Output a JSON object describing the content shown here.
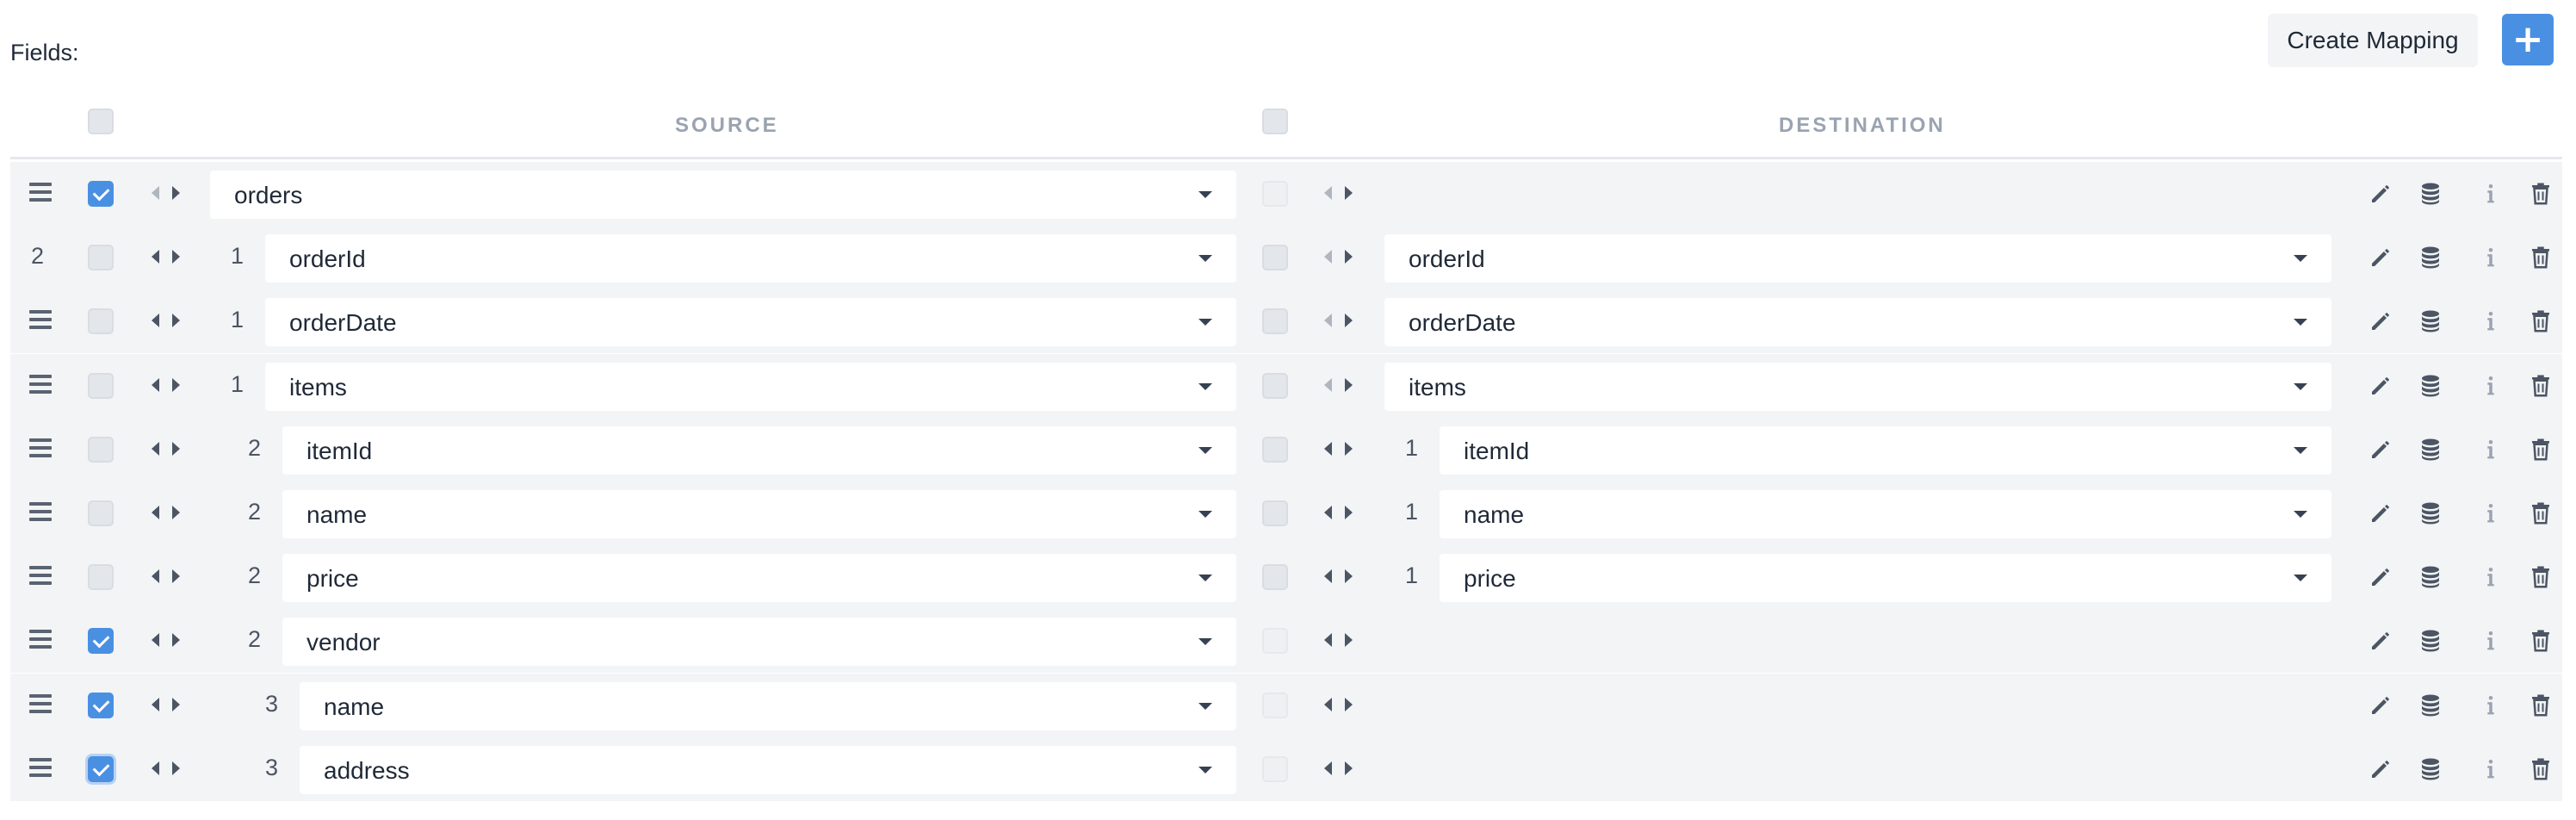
{
  "header": {
    "fields_label": "Fields:",
    "create_mapping_label": "Create Mapping",
    "add_label": "+"
  },
  "columns": {
    "source": "SOURCE",
    "destination": "DESTINATION"
  },
  "icons": {
    "drag": "drag-handle-icon",
    "edit": "pencil-icon",
    "database": "database-icon",
    "info": "info-icon",
    "delete": "trash-icon"
  },
  "colors": {
    "accent": "#4a90e2",
    "row_bg": "#f3f4f6"
  },
  "rows": [
    {
      "lead": "",
      "checked": true,
      "source_depth": "",
      "source": "orders",
      "dest_depth": "",
      "dest": ""
    },
    {
      "lead": "2",
      "checked": false,
      "source_depth": "1",
      "source": "orderId",
      "dest_depth": "",
      "dest": "orderId"
    },
    {
      "lead": "",
      "checked": false,
      "source_depth": "1",
      "source": "orderDate",
      "dest_depth": "",
      "dest": "orderDate"
    },
    {
      "lead": "",
      "checked": false,
      "source_depth": "1",
      "source": "items",
      "dest_depth": "",
      "dest": "items"
    },
    {
      "lead": "",
      "checked": false,
      "source_depth": "2",
      "source": "itemId",
      "dest_depth": "1",
      "dest": "itemId"
    },
    {
      "lead": "",
      "checked": false,
      "source_depth": "2",
      "source": "name",
      "dest_depth": "1",
      "dest": "name"
    },
    {
      "lead": "",
      "checked": false,
      "source_depth": "2",
      "source": "price",
      "dest_depth": "1",
      "dest": "price"
    },
    {
      "lead": "",
      "checked": true,
      "source_depth": "2",
      "source": "vendor",
      "dest_depth": "",
      "dest": ""
    },
    {
      "lead": "",
      "checked": true,
      "source_depth": "3",
      "source": "name",
      "dest_depth": "",
      "dest": ""
    },
    {
      "lead": "",
      "checked": true,
      "source_depth": "3",
      "source": "address",
      "dest_depth": "",
      "dest": ""
    }
  ]
}
